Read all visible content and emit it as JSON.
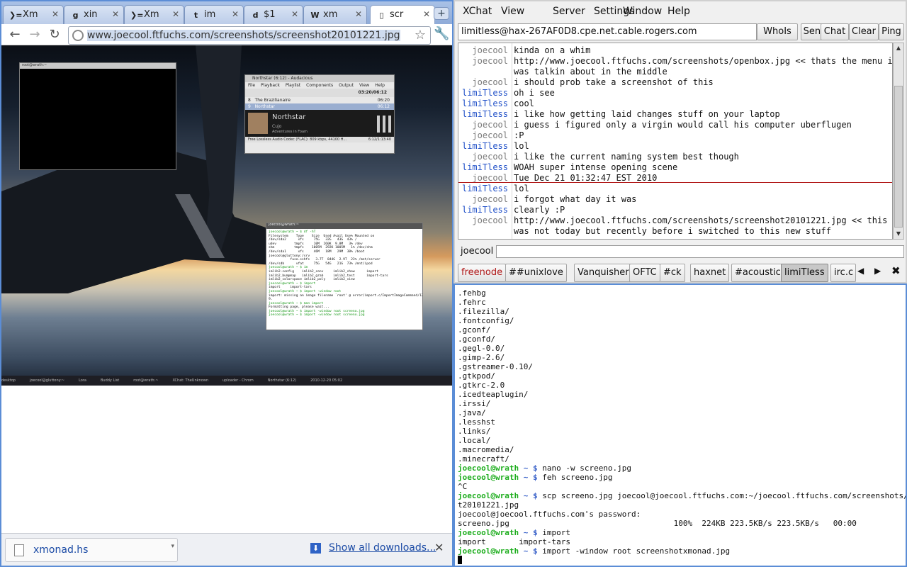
{
  "chrome": {
    "tabs": [
      {
        "label": "Xm",
        "icon": "xmonad-icon",
        "glyph": "❯="
      },
      {
        "label": "xin",
        "icon": "google-icon",
        "glyph": "g"
      },
      {
        "label": "Xm",
        "icon": "xmonad-icon",
        "glyph": "❯="
      },
      {
        "label": "im",
        "icon": "twitter-icon",
        "glyph": "t"
      },
      {
        "label": "$1",
        "icon": "dice-icon",
        "glyph": "d"
      },
      {
        "label": "xm",
        "icon": "wikipedia-icon",
        "glyph": "W"
      },
      {
        "label": "scr",
        "icon": "page-icon",
        "glyph": "▯"
      }
    ],
    "url": "www.joecool.ftfuchs.com/screenshots/screenshot20101221.jpg",
    "downloads": {
      "file_name": "xmonad.hs",
      "show_all": "Show all downloads..."
    }
  },
  "screenshot_inner": {
    "term1_title": "root@wrath:~",
    "audacious": {
      "title": "Northstar (6:12) - Audacious",
      "menu": [
        "File",
        "Playback",
        "Playlist",
        "Components",
        "Output",
        "View",
        "Help"
      ],
      "time": "03:20/06:12",
      "rows": [
        {
          "num": "8",
          "title": "The Brazilianaire",
          "len": "06:20"
        },
        {
          "num": "9",
          "title": "Northstar",
          "len": "06:12"
        }
      ],
      "track": "Northstar",
      "artist": "Cujo",
      "album": "Adventures in Foam",
      "status": "Free Lossless Audio Codec (FLAC): 809 kbps, 44100 H...",
      "status_time": "6:12/1:13:40"
    },
    "term2_title": "joecool@wrath:~",
    "term2_lines": [
      "joecool@wrath ~ $ df -hT",
      "Filesystem    Type    Size  Used Avail Use% Mounted on",
      "/dev/sda2      xfs     75G   32G   43G  43% /",
      "udev         tmpfs     10M  260K  9.8M   3% /dev",
      "shm          tmpfs    1005M  292K 1005M   1% /dev/shm",
      "/dev/sda1      xfs     46M   18M   29M  38% /boot",
      "joecool@gluttony:/srv",
      "           fuse.sshfs   3.7T  844G  2.9T  23% /mnt/server",
      "/dev/sdb      vfat     75G   54G   21G  73% /mnt/ipod",
      "joecool@wrath ~ $ im",
      "imlib2-config    imlib2_conv     imlib2_show      import",
      "imlib2_bumpmap   imlib2_grab     imlib2_test      import-tars",
      "imlib2_colorspace imlib2_poly    imlib2_view",
      "joecool@wrath ~ $ import",
      "import     import-tars",
      "joecool@wrath ~ $ import -window root",
      "import: missing an image filename `root' @ error/import.c/ImportImageCommand/128",
      "9.",
      "joecool@wrath ~ $ man import",
      "Formatting page, please wait...",
      "joecool@wrath ~ $ import -window root screeno.jpg",
      "joecool@wrath ~ $ import -window root screeno.jpg"
    ],
    "panel_items": [
      "desktop",
      "joecool@gluttony:~",
      "Lora",
      "Buddy List",
      "root@wrath:~",
      "XChat: TheUnknown",
      "uploader - Chrom",
      "Northstar (6:12)",
      "2010-12-20 05:02"
    ]
  },
  "xchat": {
    "menu": [
      "XChat",
      "View",
      "Server",
      "Settings",
      "Window",
      "Help"
    ],
    "topic": "limitless@hax-267AF0D8.cpe.net.cable.rogers.com",
    "buttons": [
      "WhoIs",
      "Send",
      "Chat",
      "Clear",
      "Ping"
    ],
    "lines": [
      {
        "nick": "joecool",
        "type": "j",
        "text": "kinda on a whim"
      },
      {
        "nick": "joecool",
        "type": "j",
        "text": "http://www.joecool.ftfuchs.com/screenshots/openbox.jpg << thats the menu i"
      },
      {
        "nick": "",
        "type": "j",
        "text": "was talkin about in the middle"
      },
      {
        "nick": "joecool",
        "type": "j",
        "text": "i should prob take a screenshot of this"
      },
      {
        "nick": "limiTless",
        "type": "l",
        "text": "oh i see"
      },
      {
        "nick": "limiTless",
        "type": "l",
        "text": "cool"
      },
      {
        "nick": "limiTless",
        "type": "l",
        "text": "i like how getting laid changes stuff on your laptop"
      },
      {
        "nick": "joecool",
        "type": "j",
        "text": "i guess i figured only a virgin would call his computer uberflugen"
      },
      {
        "nick": "joecool",
        "type": "j",
        "text": ":P"
      },
      {
        "nick": "limiTless",
        "type": "l",
        "text": "lol"
      },
      {
        "nick": "joecool",
        "type": "j",
        "text": "i like the current naming system best though"
      },
      {
        "nick": "limiTless",
        "type": "l",
        "text": "WOAH super intense opening scene"
      },
      {
        "nick": "joecool",
        "type": "j",
        "text": "Tue Dec 21 01:32:47 EST 2010"
      },
      {
        "nick": "limiTless",
        "type": "l",
        "text": "lol"
      },
      {
        "nick": "joecool",
        "type": "j",
        "text": "i forgot what day it was"
      },
      {
        "nick": "limiTless",
        "type": "l",
        "text": "clearly :P"
      },
      {
        "nick": "joecool",
        "type": "j",
        "text": "http://www.joecool.ftfuchs.com/screenshots/screenshot20101221.jpg << this"
      },
      {
        "nick": "",
        "type": "j",
        "text": "was not today but recently before i switched to this new stuff"
      }
    ],
    "my_nick": "joecool",
    "channels": [
      {
        "label": "freenode",
        "kind": "server"
      },
      {
        "label": "##unixlove",
        "kind": "channel"
      },
      {
        "label": "Vanquisher",
        "kind": "channel"
      },
      {
        "label": "OFTC",
        "kind": "channel"
      },
      {
        "label": "#ck",
        "kind": "channel"
      },
      {
        "label": "haxnet",
        "kind": "channel"
      },
      {
        "label": "#acoustic",
        "kind": "channel"
      },
      {
        "label": "limiTless",
        "kind": "current"
      },
      {
        "label": "irc.c",
        "kind": "channel"
      }
    ]
  },
  "terminal": {
    "lines": [
      ".fehbg",
      ".fehrc",
      ".filezilla/",
      ".fontconfig/",
      ".gconf/",
      ".gconfd/",
      ".gegl-0.0/",
      ".gimp-2.6/",
      ".gstreamer-0.10/",
      ".gtkpod/",
      ".gtkrc-2.0",
      ".icedteaplugin/",
      ".irssi/",
      ".java/",
      ".lesshst",
      ".links/",
      ".local/",
      ".macromedia/",
      ".minecraft/"
    ],
    "prompt_user": "joecool@wrath",
    "prompt_dir": "~ $",
    "session": [
      {
        "type": "cmd",
        "text": "nano -w screeno.jpg"
      },
      {
        "type": "cmd",
        "text": "feh screeno.jpg"
      },
      {
        "type": "out",
        "text": "^C"
      },
      {
        "type": "cmd",
        "text": "scp screeno.jpg joecool@joecool.ftfuchs.com:~/joecool.ftfuchs.com/screenshots/screensho"
      },
      {
        "type": "out",
        "text": "t20101221.jpg"
      },
      {
        "type": "out",
        "text": "joecool@joecool.ftfuchs.com's password:"
      },
      {
        "type": "out",
        "text": "screeno.jpg                                   100%  224KB 223.5KB/s 223.5KB/s   00:00"
      },
      {
        "type": "cmd",
        "text": "import"
      },
      {
        "type": "out",
        "text": "import       import-tars"
      },
      {
        "type": "cmd",
        "text": "import -window root screenshotxmonad.jpg"
      }
    ]
  },
  "colors": {
    "chrome_frame": "#5b8dd6",
    "nick_self": "#2050c8",
    "nick_other": "#7a7a7a",
    "prompt_green": "#1fae1f",
    "prompt_blue": "#3a62c9",
    "server_tab": "#b01818"
  }
}
